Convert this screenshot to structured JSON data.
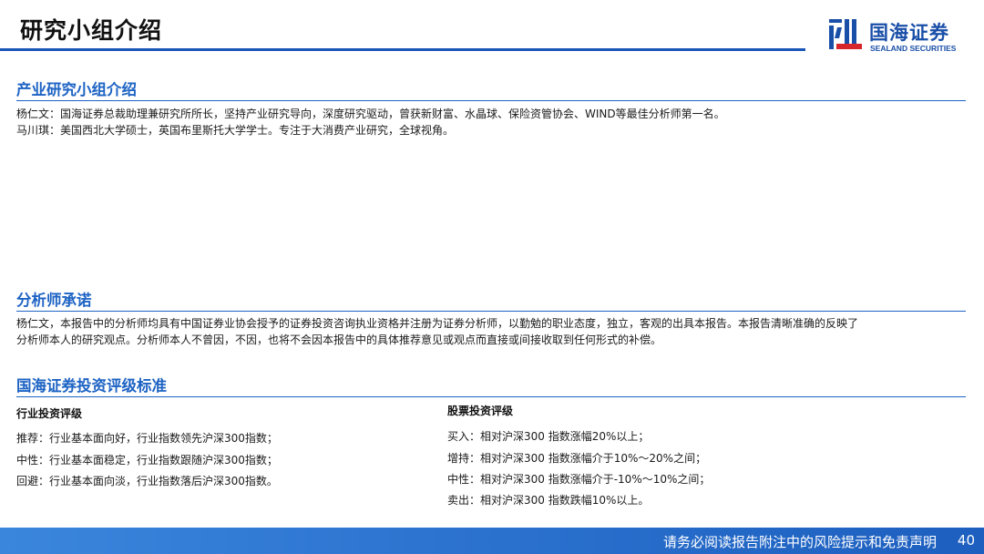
{
  "header": {
    "title": "研究小组介绍",
    "logo_cn": "国海证券",
    "logo_en": "SEALAND SECURITIES",
    "accent_color": "#1a56b8"
  },
  "team": {
    "heading": "产业研究小组介绍",
    "lines": [
      "杨仁文：国海证券总裁助理兼研究所所长，坚持产业研究导向，深度研究驱动，曾获新财富、水晶球、保险资管协会、WIND等最佳分析师第一名。",
      "马川琪：美国西北大学硕士，英国布里斯托大学学士。专注于大消费产业研究，全球视角。"
    ]
  },
  "commitment": {
    "heading": "分析师承诺",
    "lines": [
      "杨仁文，本报告中的分析师均具有中国证券业协会授予的证券投资咨询执业资格并注册为证券分析师，以勤勉的职业态度，独立，客观的出具本报告。本报告清晰准确的反映了",
      "分析师本人的研究观点。分析师本人不曾因，不因，也将不会因本报告中的具体推荐意见或观点而直接或间接收取到任何形式的补偿。"
    ]
  },
  "rating": {
    "heading": "国海证券投资评级标准",
    "industry": {
      "title": "行业投资评级",
      "items": [
        "推荐：行业基本面向好，行业指数领先沪深300指数；",
        "中性：行业基本面稳定，行业指数跟随沪深300指数；",
        "回避：行业基本面向淡，行业指数落后沪深300指数。"
      ]
    },
    "stock": {
      "title": "股票投资评级",
      "items": [
        "买入：相对沪深300 指数涨幅20%以上；",
        "增持：相对沪深300 指数涨幅介于10%～20%之间；",
        "中性：相对沪深300 指数涨幅介于-10%～10%之间；",
        "卖出：相对沪深300 指数跌幅10%以上。"
      ]
    }
  },
  "footer": {
    "disclaimer": "请务必阅读报告附注中的风险提示和免责声明",
    "page_number": "40"
  }
}
